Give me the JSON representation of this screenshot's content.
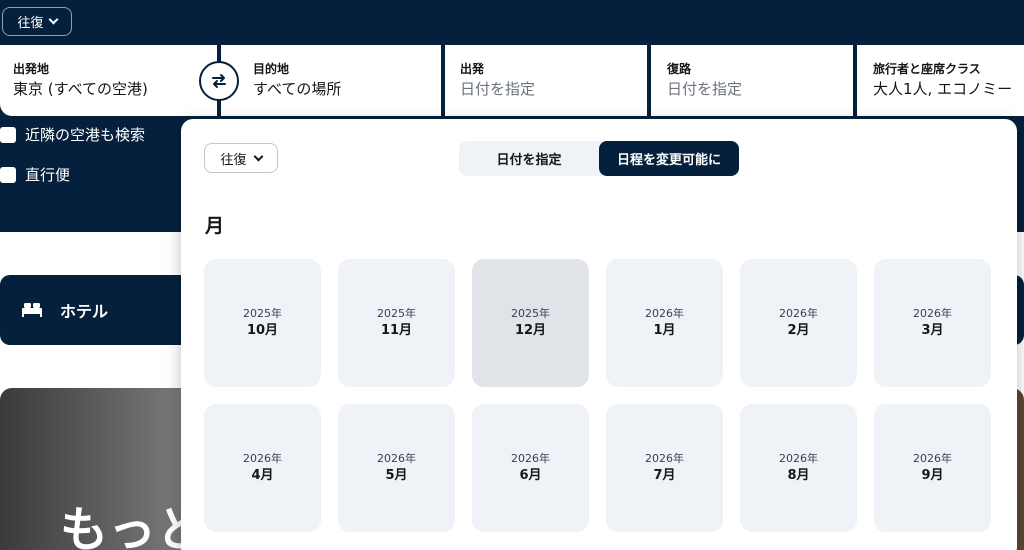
{
  "header": {
    "trip_type": "往復"
  },
  "search": {
    "origin": {
      "label": "出発地",
      "value": "東京 (すべての空港)"
    },
    "destination": {
      "label": "目的地",
      "value": "すべての場所"
    },
    "depart": {
      "label": "出発",
      "value": "日付を指定"
    },
    "return": {
      "label": "復路",
      "value": "日付を指定"
    },
    "travellers": {
      "label": "旅行者と座席クラス",
      "value": "大人1人, エコノミー"
    },
    "swap_icon": "swap-arrows-icon"
  },
  "options": {
    "nearby": "近隣の空港も検索",
    "direct": "直行便"
  },
  "hotel": {
    "label": "ホテル",
    "icon": "bed-icon"
  },
  "hero": {
    "text": "もっと"
  },
  "popup": {
    "trip_type": "往復",
    "tabs": [
      {
        "label": "日付を指定",
        "active": false
      },
      {
        "label": "日程を変更可能に",
        "active": true
      }
    ],
    "heading": "月",
    "months": [
      {
        "year": "2025年",
        "month": "10月"
      },
      {
        "year": "2025年",
        "month": "11月"
      },
      {
        "year": "2025年",
        "month": "12月"
      },
      {
        "year": "2026年",
        "month": "1月"
      },
      {
        "year": "2026年",
        "month": "2月"
      },
      {
        "year": "2026年",
        "month": "3月"
      },
      {
        "year": "2026年",
        "month": "4月"
      },
      {
        "year": "2026年",
        "month": "5月"
      },
      {
        "year": "2026年",
        "month": "6月"
      },
      {
        "year": "2026年",
        "month": "7月"
      },
      {
        "year": "2026年",
        "month": "8月"
      },
      {
        "year": "2026年",
        "month": "9月"
      }
    ],
    "selected_month": "12月"
  },
  "colors": {
    "brand_navy": "#05203c",
    "tile_bg": "#eff3f8",
    "tile_selected": "#e0e4e9"
  }
}
